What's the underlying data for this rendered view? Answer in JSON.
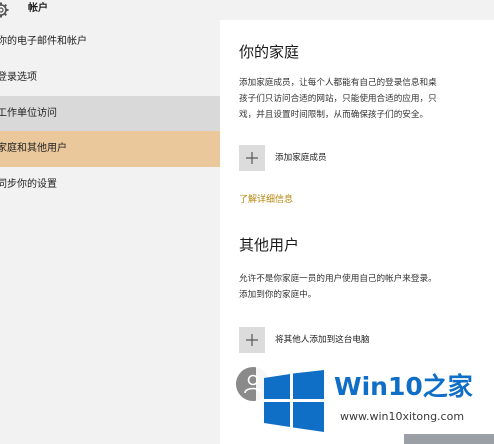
{
  "window": {
    "title": "帐户"
  },
  "sidebar": {
    "items": [
      {
        "label": "你的电子邮件和帐户"
      },
      {
        "label": "登录选项"
      },
      {
        "label": "工作单位访问"
      },
      {
        "label": "家庭和其他用户"
      },
      {
        "label": "同步你的设置"
      }
    ],
    "selected_index": 3,
    "hover_index": 2
  },
  "family": {
    "heading": "你的家庭",
    "description_lines": [
      "添加家庭成员，让每个人都能有自己的登录信息和桌",
      "孩子们只访问合适的网站，只能使用合适的应用，只",
      "戏，并且设置时间限制，从而确保孩子们的安全。"
    ],
    "add_label": "添加家庭成员",
    "learn_more": "了解详细信息"
  },
  "others": {
    "heading": "其他用户",
    "description_lines": [
      "允许不是你家庭一员的用户使用自己的帐户来登录。",
      "添加到你的家庭中。"
    ],
    "add_label": "将其他人添加到这台电脑"
  },
  "watermark": {
    "brand": "Win10",
    "suffix": "之家",
    "url": "www.win10xitong.com"
  },
  "colors": {
    "accent": "#b8860b",
    "selected_bg": "#ebc89c",
    "hover_bg": "#d9d9d9",
    "sidebar_bg": "#f2f2f2",
    "watermark_blue": "#0f6fc6"
  },
  "icons": {
    "title": "gear-icon",
    "add": "plus-icon",
    "avatar": "person-icon",
    "watermark": "windows-logo-icon"
  }
}
